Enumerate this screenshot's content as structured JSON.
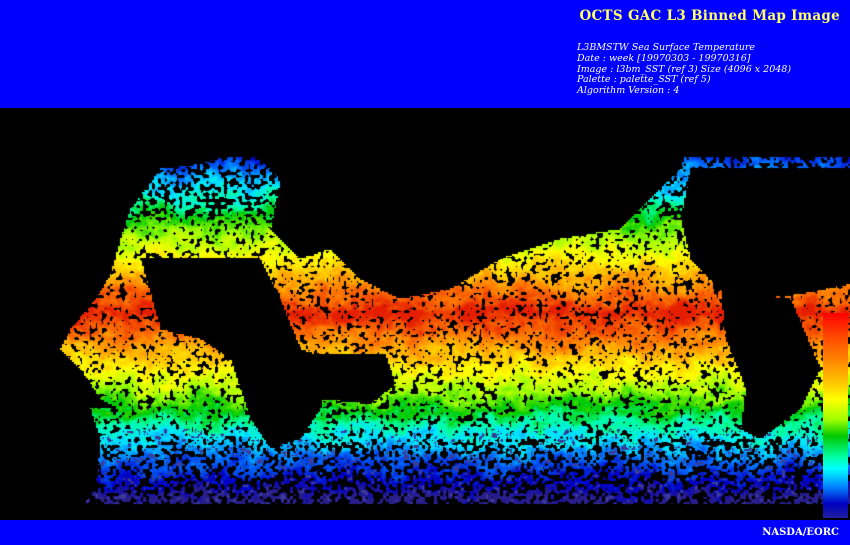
{
  "header": {
    "title": "OCTS GAC L3 Binned Map Image",
    "lines": [
      "L3BMSTW Sea Surface Temperature",
      "Date : week [19970303 - 19970316]",
      "Image : l3bm_SST (ref 3) Size (4096 x 2048)",
      "Palette : palette_SST (ref 5)",
      "Algorithm Version : 4"
    ]
  },
  "footer": {
    "credit": "NASDA/EORC"
  },
  "colors": {
    "banner": "#0000ff",
    "title_text": "#ffff66",
    "land": "#000000"
  },
  "colorbar": {
    "palette": "palette_SST",
    "top_color": "#ff0000",
    "bottom_color": "#2020a0"
  }
}
